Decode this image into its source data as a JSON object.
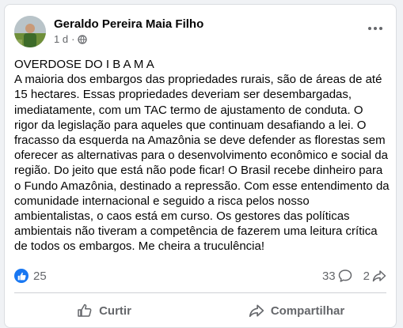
{
  "post": {
    "author": "Geraldo Pereira Maia Filho",
    "time": "1 d",
    "separator": "·",
    "privacy_icon": "globe-icon",
    "more_icon": "more-horizontal-icon",
    "title": "OVERDOSE DO I B A M A",
    "body": "A maioria dos embargos das propriedades rurais, são de áreas de até 15 hectares. Essas propriedades deveriam ser desembargadas, imediatamente, com um TAC termo de ajustamento de conduta. O rigor da legislação para aqueles que continuam desafiando a lei. O fracasso da esquerda na Amazônia se deve defender as florestas sem oferecer as alternativas para o desenvolvimento econômico e social da região. Do jeito que está não pode ficar! O Brasil recebe dinheiro para o Fundo Amazônia, destinado a repressão. Com esse entendimento da comunidade internacional e seguido a risca pelos nosso ambientalistas, o caos está em curso. Os gestores das políticas ambientais não tiveram a competência de fazerem uma leitura crítica de todos os embargos. Me cheira a truculência!"
  },
  "stats": {
    "likes": "25",
    "comments": "33",
    "shares": "2"
  },
  "actions": {
    "like_label": "Curtir",
    "share_label": "Compartilhar"
  },
  "colors": {
    "accent": "#1877f2",
    "text": "#050505",
    "muted": "#65676b"
  }
}
